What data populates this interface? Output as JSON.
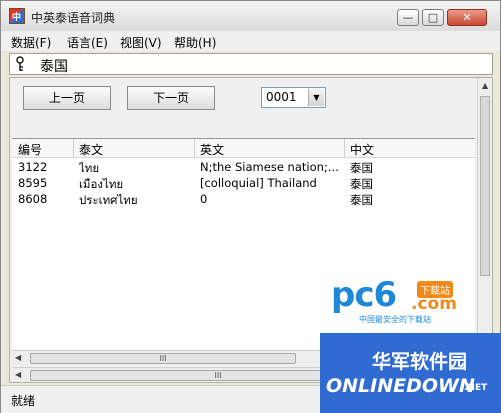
{
  "window": {
    "title": "中英泰语音词典",
    "app_icon_text": "中"
  },
  "window_controls": {
    "minimize": "—",
    "maximize": "□",
    "close": "✕"
  },
  "menu": [
    {
      "label": "数据(F)"
    },
    {
      "label": "语言(E)"
    },
    {
      "label": "视图(V)"
    },
    {
      "label": "帮助(H)"
    }
  ],
  "search": {
    "value": "泰国",
    "icon": "key-icon"
  },
  "nav": {
    "prev_label": "上一页",
    "next_label": "下一页",
    "page_select": "0001",
    "dropdown_arrow": "▼"
  },
  "table": {
    "headers": [
      "编号",
      "泰文",
      "英文",
      "中文"
    ],
    "rows": [
      {
        "id": "3122",
        "thai": "ไทย",
        "english": " N;the Siamese nation;...",
        "chinese": "泰国"
      },
      {
        "id": "8595",
        "thai": "เมืองไทย",
        "english": "[colloquial] Thailand",
        "chinese": "泰国"
      },
      {
        "id": "8608",
        "thai": "ประเทศไทย",
        "english": "0",
        "chinese": "泰国"
      }
    ]
  },
  "scrollbars": {
    "grip": "III",
    "left_arrow": "◀",
    "right_arrow": "▶",
    "up_arrow": "▲",
    "down_arrow": "▼"
  },
  "status": {
    "text": "就绪"
  },
  "watermarks": {
    "pc6_logo": "pc6",
    "pc6_badge": "下载站",
    "pc6_domain": ".com",
    "pc6_slogan": "中国最安全的下载站",
    "onlinedown_cn": "华军软件园",
    "onlinedown_en": "ONLINEDOWN",
    "onlinedown_tld": ".NET"
  },
  "colors": {
    "watermark_blue": "#2f6bd0",
    "pc6_orange": "#f28a1a",
    "pc6_blue": "#1e88d6"
  }
}
